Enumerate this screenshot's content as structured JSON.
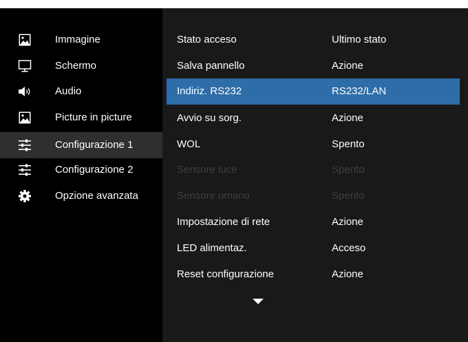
{
  "colors": {
    "background": "#000000",
    "panel": "#191919",
    "active_category": "#2f2f2f",
    "highlight": "#2e6da8",
    "text": "#ffffff",
    "disabled_text": "#3f3f3f"
  },
  "sidebar": {
    "items": [
      {
        "label": "Immagine",
        "icon": "picture-icon",
        "active": false
      },
      {
        "label": "Schermo",
        "icon": "monitor-icon",
        "active": false
      },
      {
        "label": "Audio",
        "icon": "speaker-icon",
        "active": false
      },
      {
        "label": "Picture in picture",
        "icon": "picture-in-picture-icon",
        "active": false
      },
      {
        "label": "Configurazione 1",
        "icon": "sliders-icon",
        "active": true
      },
      {
        "label": "Configurazione 2",
        "icon": "sliders-icon",
        "active": false
      },
      {
        "label": "Opzione avanzata",
        "icon": "gear-icon",
        "active": false
      }
    ]
  },
  "settings": {
    "rows": [
      {
        "name": "Stato acceso",
        "value": "Ultimo stato",
        "state": "normal"
      },
      {
        "name": "Salva pannello",
        "value": "Azione",
        "state": "normal"
      },
      {
        "name": "Indiriz. RS232",
        "value": "RS232/LAN",
        "state": "selected"
      },
      {
        "name": "Avvio su sorg.",
        "value": "Azione",
        "state": "normal"
      },
      {
        "name": "WOL",
        "value": "Spento",
        "state": "normal"
      },
      {
        "name": "Sensore luce",
        "value": "Spento",
        "state": "disabled"
      },
      {
        "name": "Sensore umano",
        "value": "Spento",
        "state": "disabled"
      },
      {
        "name": "Impostazione di rete",
        "value": "Azione",
        "state": "normal"
      },
      {
        "name": "LED alimentaz.",
        "value": "Acceso",
        "state": "normal"
      },
      {
        "name": "Reset configurazione",
        "value": "Azione",
        "state": "normal"
      }
    ],
    "more_indicator_icon": "caret-down-icon"
  }
}
